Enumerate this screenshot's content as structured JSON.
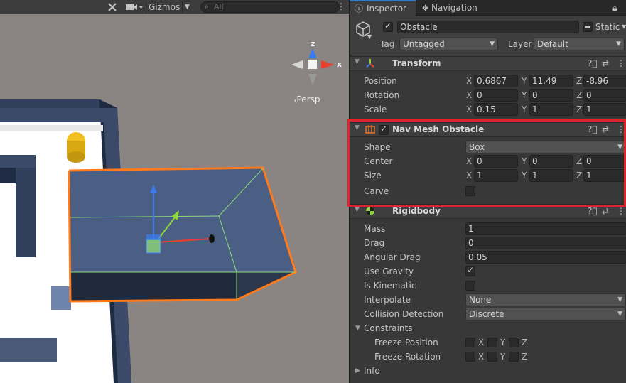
{
  "scene": {
    "toolbar": {
      "gizmos_label": "Gizmos",
      "search_placeholder": "All",
      "kebab": "⋮"
    },
    "persp_label": "Persp",
    "gizmo_axes": {
      "z": "z",
      "x": "x"
    }
  },
  "inspector": {
    "tabs": {
      "inspector": "Inspector",
      "navigation": "Navigation"
    },
    "object": {
      "active": true,
      "name": "Obstacle",
      "static_label": "Static",
      "tag_label": "Tag",
      "tag_value": "Untagged",
      "layer_label": "Layer",
      "layer_value": "Default"
    },
    "transform": {
      "title": "Transform",
      "position_label": "Position",
      "rotation_label": "Rotation",
      "scale_label": "Scale",
      "position": {
        "x": "0.6867",
        "y": "11.49",
        "z": "-8.96"
      },
      "rotation": {
        "x": "0",
        "y": "0",
        "z": "0"
      },
      "scale": {
        "x": "0.15",
        "y": "1",
        "z": "1"
      }
    },
    "nav_mesh_obstacle": {
      "title": "Nav Mesh Obstacle",
      "enabled": true,
      "shape_label": "Shape",
      "shape_value": "Box",
      "center_label": "Center",
      "size_label": "Size",
      "carve_label": "Carve",
      "center": {
        "x": "0",
        "y": "0",
        "z": "0"
      },
      "size": {
        "x": "1",
        "y": "1",
        "z": "1"
      },
      "carve": false
    },
    "rigidbody": {
      "title": "Rigidbody",
      "mass_label": "Mass",
      "mass": "1",
      "drag_label": "Drag",
      "drag": "0",
      "angular_drag_label": "Angular Drag",
      "angular_drag": "0.05",
      "use_gravity_label": "Use Gravity",
      "use_gravity": true,
      "is_kinematic_label": "Is Kinematic",
      "is_kinematic": false,
      "interpolate_label": "Interpolate",
      "interpolate_value": "None",
      "collision_label": "Collision Detection",
      "collision_value": "Discrete",
      "constraints_label": "Constraints",
      "freeze_position_label": "Freeze Position",
      "freeze_rotation_label": "Freeze Rotation",
      "info_label": "Info"
    },
    "axis_letters": {
      "x": "X",
      "y": "Y",
      "z": "Z"
    }
  },
  "colors": {
    "highlight": "#e0222a",
    "selection_outline": "#ff7a1a",
    "axis_x": "#e8402d",
    "axis_y": "#8ed63a",
    "axis_z": "#3a7cf0"
  }
}
